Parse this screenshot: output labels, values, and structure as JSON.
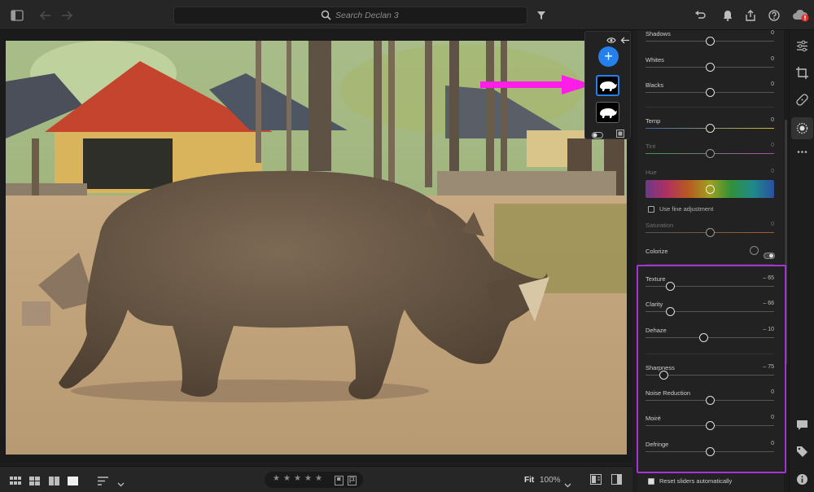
{
  "search": {
    "placeholder": "Search Declan 3"
  },
  "colors": {
    "accent": "#2680eb",
    "highlight_border": "#a533d6",
    "annotation_arrow": "#ff1ee8",
    "alert": "#e0302a"
  },
  "topbar": {
    "icons": [
      "sidebar-toggle-icon",
      "back-arrow-icon",
      "forward-arrow-icon",
      "search-icon",
      "filter-icon",
      "undo-icon",
      "notifications-icon",
      "share-icon",
      "help-icon",
      "cloud-sync-alert-icon"
    ]
  },
  "masks": {
    "icons": [
      "eye-icon",
      "back-arrow-icon",
      "add-mask-icon",
      "mask-rhino-icon",
      "toggle-overlay-icon",
      "overlay-mode-icon"
    ],
    "add_label": "+"
  },
  "panel": {
    "shadows": {
      "label": "Shadows",
      "value": "0",
      "position": 0.5
    },
    "whites": {
      "label": "Whites",
      "value": "0",
      "position": 0.5
    },
    "blacks": {
      "label": "Blacks",
      "value": "0",
      "position": 0.5
    },
    "temp": {
      "label": "Temp",
      "value": "0",
      "position": 0.5
    },
    "tint": {
      "label": "Tint",
      "value": "0",
      "position": 0.5
    },
    "hue": {
      "label": "Hue",
      "value": "0",
      "position": 0.5
    },
    "fine_adjustment": {
      "label": "Use fine adjustment",
      "checked": false
    },
    "saturation": {
      "label": "Saturation",
      "value": "0",
      "position": 0.5
    },
    "colorize": {
      "label": "Colorize"
    },
    "texture": {
      "label": "Texture",
      "value": "– 65",
      "position": 0.19
    },
    "clarity": {
      "label": "Clarity",
      "value": "– 66",
      "position": 0.19
    },
    "dehaze": {
      "label": "Dehaze",
      "value": "– 10",
      "position": 0.45
    },
    "sharpness": {
      "label": "Sharpness",
      "value": "– 75",
      "position": 0.14
    },
    "noise_reduction": {
      "label": "Noise Reduction",
      "value": "0",
      "position": 0.5
    },
    "moire": {
      "label": "Moiré",
      "value": "0",
      "position": 0.5
    },
    "defringe": {
      "label": "Defringe",
      "value": "0",
      "position": 0.5
    },
    "reset_sliders": {
      "label": "Reset sliders automatically",
      "checked": true
    }
  },
  "rail": {
    "icons": [
      "edit-sliders-icon",
      "crop-icon",
      "healing-icon",
      "masking-icon",
      "more-icon",
      "comments-icon",
      "tag-icon",
      "info-icon"
    ]
  },
  "bottombar": {
    "views": [
      "grid-view-icon",
      "square-grid-view-icon",
      "compare-view-icon",
      "detail-view-icon",
      "sort-icon",
      "chevron-down-icon"
    ],
    "rating": 0,
    "stars": [
      "★",
      "★",
      "★",
      "★",
      "★"
    ],
    "flags": [
      "flag-pick-icon",
      "flag-reject-icon"
    ],
    "fit_label": "Fit",
    "zoom_label": "100%",
    "right_icons": [
      "before-after-icon",
      "split-view-icon"
    ]
  }
}
